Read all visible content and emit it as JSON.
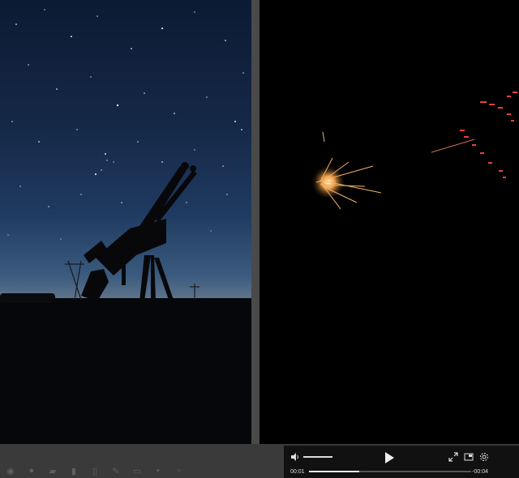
{
  "player": {
    "current_time": "00:01",
    "remaining_time": "-00:04",
    "progress": 0.31,
    "volume": 0.85
  },
  "icons": {
    "volume": "speaker-icon",
    "play": "play-icon",
    "fullscreen": "fullscreen-icon",
    "pip": "picture-in-picture-icon",
    "settings": "gear-icon"
  },
  "taskbar": {
    "icons": [
      "start-icon",
      "browser-icon",
      "folder-icon",
      "files-icon",
      "document-icon",
      "edit-icon",
      "mail-icon",
      "chat-icon",
      "trash-icon"
    ]
  },
  "colors": {
    "video_bg": "#000000",
    "controls_bg": "#111111",
    "gutter": "#4a4a4a",
    "spark": "#ff5a3c"
  }
}
